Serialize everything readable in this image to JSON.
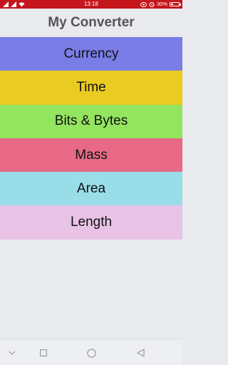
{
  "status_bar": {
    "time": "13:18",
    "battery_text": "30%",
    "battery_level": 0.3,
    "bg_color": "#c4161c"
  },
  "app": {
    "title": "My Converter"
  },
  "menu": {
    "items": [
      {
        "label": "Currency",
        "color": "#7b7de6"
      },
      {
        "label": "Time",
        "color": "#eacb22"
      },
      {
        "label": "Bits & Bytes",
        "color": "#93e45f"
      },
      {
        "label": "Mass",
        "color": "#e86a86"
      },
      {
        "label": "Area",
        "color": "#99dde9"
      },
      {
        "label": "Length",
        "color": "#e8c3e6"
      }
    ]
  },
  "nav_bar": {
    "buttons": [
      "chevron-down-icon",
      "square-icon",
      "circle-icon",
      "triangle-back-icon"
    ]
  }
}
